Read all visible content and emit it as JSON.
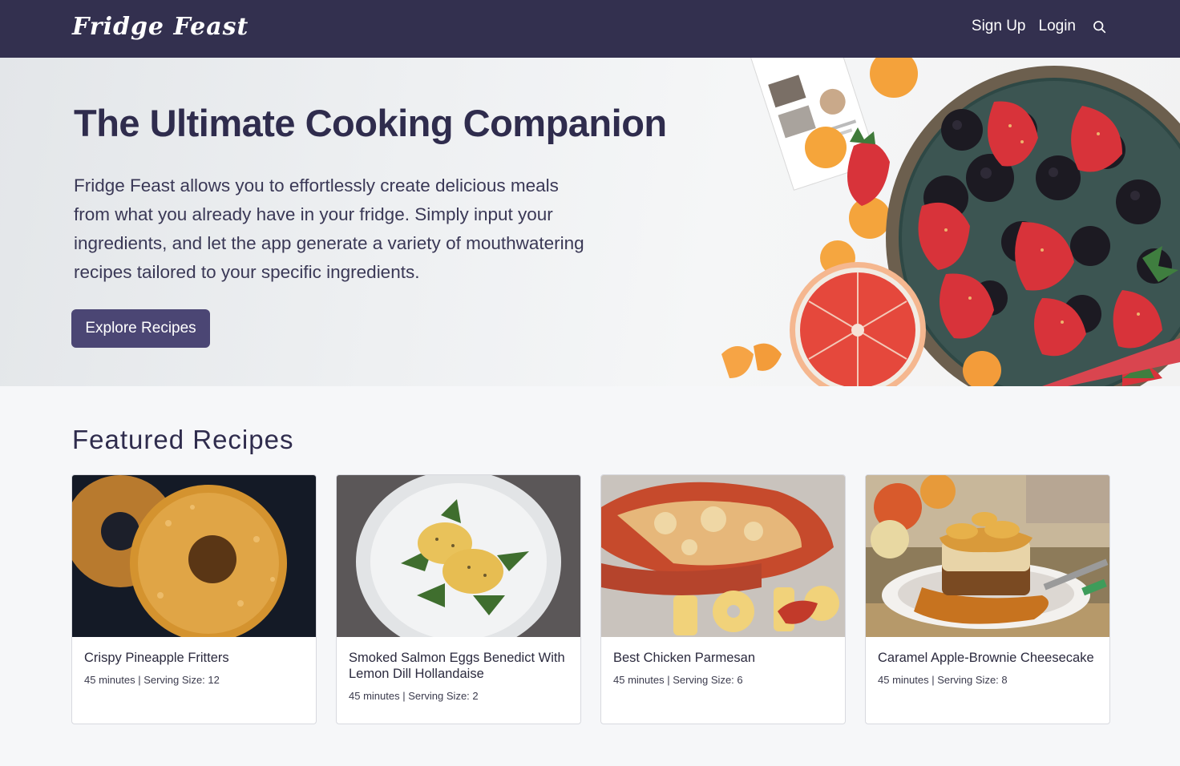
{
  "nav": {
    "logo": "Fridge Feast",
    "signup_label": "Sign Up",
    "login_label": "Login",
    "search_icon": "search-icon"
  },
  "hero": {
    "title": "The Ultimate Cooking Companion",
    "description": "Fridge Feast allows you to effortlessly create delicious meals from what you already have in your fridge. Simply input your ingredients, and let the app generate a variety of mouthwatering recipes tailored to your specific ingredients.",
    "cta_label": "Explore Recipes"
  },
  "featured": {
    "title": "Featured Recipes",
    "recipes": [
      {
        "title": "Crispy Pineapple Fritters",
        "meta": "45 minutes | Serving Size: 12"
      },
      {
        "title": "Smoked Salmon Eggs Benedict With Lemon Dill Hollandaise",
        "meta": "45 minutes | Serving Size: 2"
      },
      {
        "title": "Best Chicken Parmesan",
        "meta": "45 minutes | Serving Size: 6"
      },
      {
        "title": "Caramel Apple-Brownie Cheesecake",
        "meta": "45 minutes | Serving Size: 8"
      }
    ]
  },
  "colors": {
    "navbar": "#33304f",
    "accent_button": "#4b4674",
    "heading": "#2f2c4d",
    "page_background": "#f6f7f9"
  }
}
